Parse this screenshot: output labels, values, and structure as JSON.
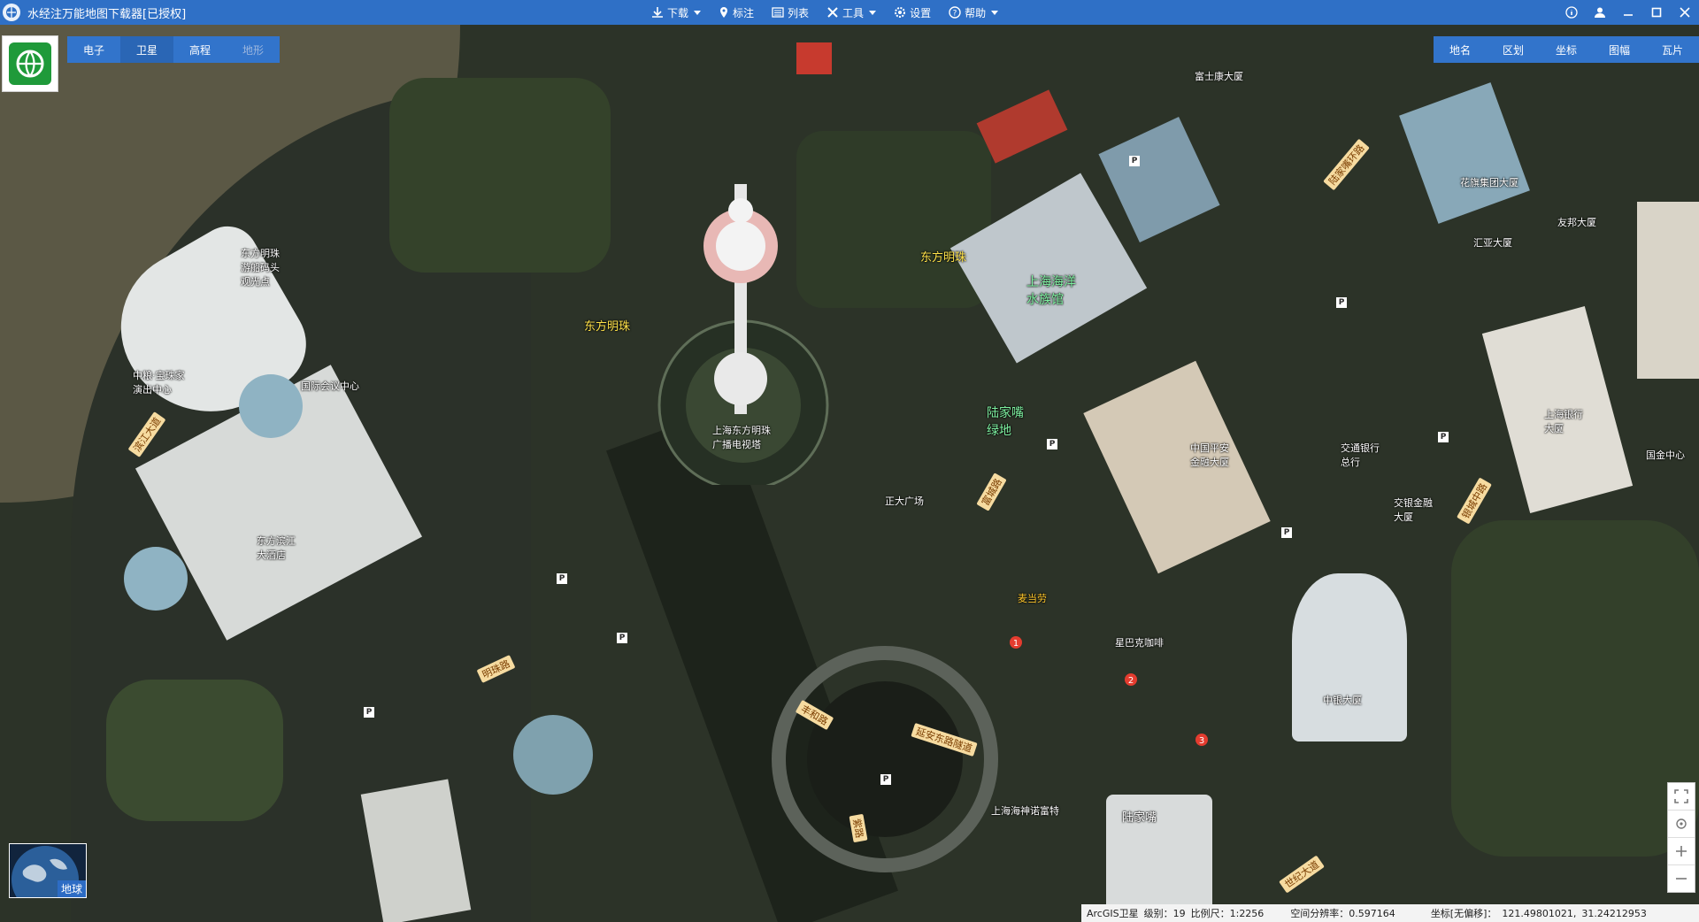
{
  "window": {
    "title": "水经注万能地图下载器[已授权]",
    "controls": [
      "info",
      "user",
      "minimize",
      "maximize",
      "close"
    ]
  },
  "menu": [
    {
      "label": "下载",
      "icon": "download-icon",
      "dropdown": true
    },
    {
      "label": "标注",
      "icon": "pin-icon",
      "dropdown": false
    },
    {
      "label": "列表",
      "icon": "list-icon",
      "dropdown": false
    },
    {
      "label": "工具",
      "icon": "tools-icon",
      "dropdown": true
    },
    {
      "label": "设置",
      "icon": "gear-icon",
      "dropdown": false
    },
    {
      "label": "帮助",
      "icon": "help-icon",
      "dropdown": true
    }
  ],
  "map_types": [
    {
      "label": "电子",
      "active": false,
      "disabled": false
    },
    {
      "label": "卫星",
      "active": true,
      "disabled": false
    },
    {
      "label": "高程",
      "active": false,
      "disabled": false
    },
    {
      "label": "地形",
      "active": false,
      "disabled": true
    }
  ],
  "right_tools": [
    "地名",
    "区划",
    "坐标",
    "图幅",
    "瓦片"
  ],
  "globe_label": "地球",
  "status": {
    "source": "ArcGIS卫星",
    "level": "级别：19",
    "scale": "比例尺：1:2256",
    "resolution": "空间分辨率：0.597164",
    "coord_label": "坐标[无偏移]：",
    "lon": "121.49801021,",
    "lat": "31.24212953"
  },
  "labels": {
    "tower": "上海东方明珠\n广播电视塔",
    "aquarium": "上海海洋\n水族馆",
    "lujiazui_garden": "陆家嘴\n绿地",
    "dongfang_mingzhu": "东方明珠",
    "dongfang_mingzhu2": "东方明珠",
    "pier": "东方明珠\n游船码头\n观光点",
    "international_conv": "中粮·宝珠家\n演出中心",
    "east_china": "东方滨江\n大酒店",
    "jinmao": "上海银行\n大厦",
    "bank_china": "中银大厦",
    "ping_an": "中国平安\n金融大厦",
    "fuji": "富士康大厦",
    "hsbc": "汇亚大厦",
    "lujiazui_station": "陆家嘴",
    "ifc": "国金中心",
    "yan_an_tunnel": "延安东路隧道",
    "century_blvd": "世纪大道",
    "lujiazui_rd": "陆家嘴环路",
    "fucheng_rd": "富城路",
    "binjiang": "滨江大道",
    "mingzhu_rd": "明珠路",
    "yincheng_rd": "银城中路",
    "fenghe_rd": "丰和路",
    "mcd": "麦当劳",
    "cafe": "星巴克咖啡",
    "hotel": "上海海神诺富特",
    "ocean_park": "上海海洋\n水族馆",
    "shop1": "正大广场",
    "shop2": "国际会议中心",
    "metro": "陆家嘴",
    "zi_lu": "紫路",
    "citibank": "花旗集团大厦",
    "jiao_bank": "交银金融\n大厦",
    "bank_comm": "交通银行\n总行",
    "aia": "友邦大厦",
    "ppark": "停车场"
  }
}
